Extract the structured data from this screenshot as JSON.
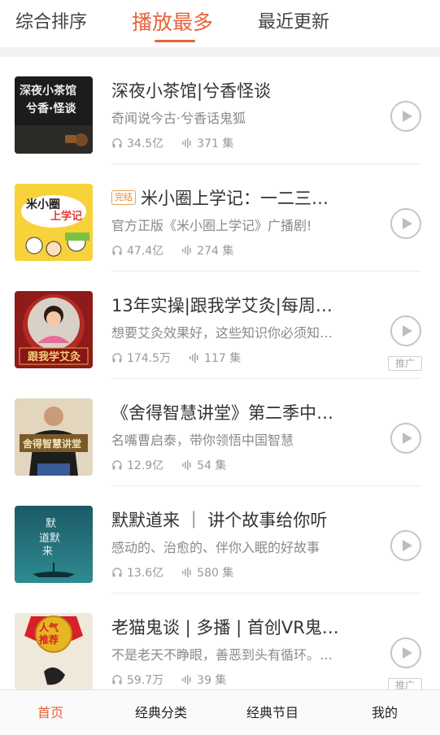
{
  "tabs": [
    {
      "label": "综合排序",
      "active": false
    },
    {
      "label": "播放最多",
      "active": true
    },
    {
      "label": "最近更新",
      "active": false
    }
  ],
  "accent_color": "#e8633a",
  "items": [
    {
      "title": "深夜小茶馆|兮香怪谈",
      "subtitle": "奇闻说今古·兮香话鬼狐",
      "plays": "34.5亿",
      "episodes": "371 集",
      "finished_label": "",
      "ad_label": "",
      "cover_text": "深夜小茶馆 兮香·怪谈"
    },
    {
      "title": "米小圈上学记：一二三…",
      "subtitle": "官方正版《米小圈上学记》广播剧!",
      "plays": "47.4亿",
      "episodes": "274 集",
      "finished_label": "完结",
      "ad_label": "",
      "cover_text": "米小圈上学记"
    },
    {
      "title": "13年实操|跟我学艾灸|每周…",
      "subtitle": "想要艾灸效果好，这些知识你必须知…",
      "plays": "174.5万",
      "episodes": "117 集",
      "finished_label": "",
      "ad_label": "推广",
      "cover_text": "跟我学艾灸"
    },
    {
      "title": "《舍得智慧讲堂》第二季中…",
      "subtitle": "名嘴曹启泰，带你领悟中国智慧",
      "plays": "12.9亿",
      "episodes": "54 集",
      "finished_label": "",
      "ad_label": "",
      "cover_text": "舍得智慧讲堂"
    },
    {
      "title": "默默道来 ｜ 讲个故事给你听",
      "subtitle": "感动的、治愈的、伴你入眠的好故事",
      "plays": "13.6亿",
      "episodes": "580 集",
      "finished_label": "",
      "ad_label": "",
      "cover_text": "默默道来"
    },
    {
      "title": "老猫鬼谈 | 多播 | 首创VR鬼…",
      "subtitle": "不是老天不睁眼，善恶到头有循环。…",
      "plays": "59.7万",
      "episodes": "39 集",
      "finished_label": "",
      "ad_label": "推广",
      "cover_text": "人气推荐"
    }
  ],
  "icons": {
    "plays": "headphones-icon",
    "episodes": "audio-wave-icon",
    "play": "play-icon"
  },
  "bottom_nav": [
    {
      "label": "首页",
      "active": true
    },
    {
      "label": "经典分类",
      "active": false
    },
    {
      "label": "经典节目",
      "active": false
    },
    {
      "label": "我的",
      "active": false
    }
  ]
}
